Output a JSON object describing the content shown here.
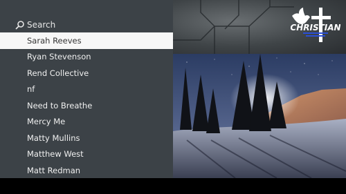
{
  "search": {
    "label": "Search"
  },
  "menu": {
    "items": [
      {
        "label": "Sarah Reeves"
      },
      {
        "label": "Ryan Stevenson"
      },
      {
        "label": "Rend Collective"
      },
      {
        "label": "nf"
      },
      {
        "label": "Need to Breathe"
      },
      {
        "label": "Mercy Me"
      },
      {
        "label": "Matty Mullins"
      },
      {
        "label": "Matthew West"
      },
      {
        "label": "Matt Redman"
      }
    ]
  },
  "logo": {
    "text": "CHRISTIAN"
  },
  "colors": {
    "panel": "#3c4247",
    "selected": "#f7f7f7",
    "logo_blue": "#2a4fd6"
  }
}
